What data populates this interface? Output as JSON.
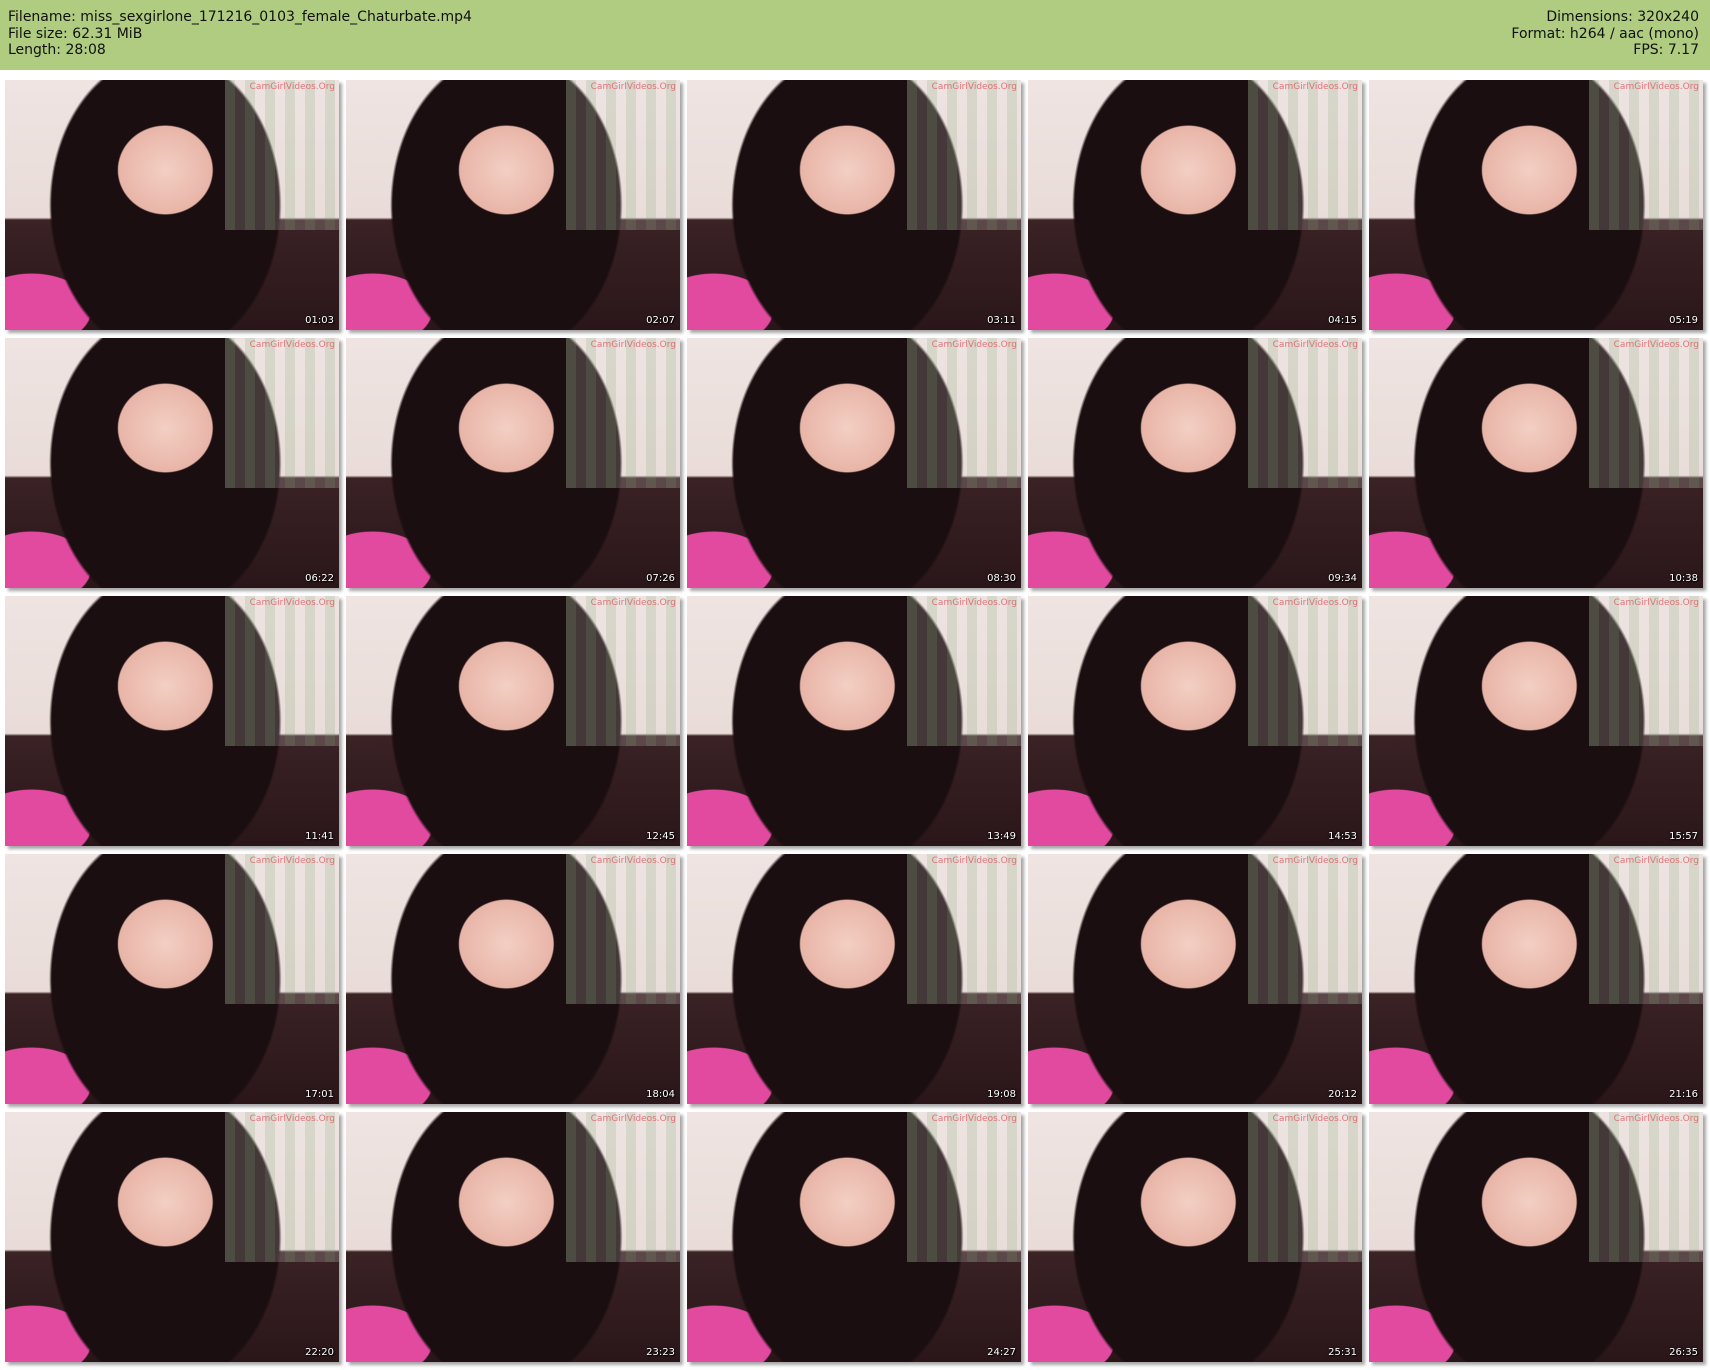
{
  "header": {
    "filename": "Filename: miss_sexgirlone_171216_0103_female_Chaturbate.mp4",
    "filesize": "File size: 62.31 MiB",
    "length": "Length: 28:08",
    "dimensions": "Dimensions: 320x240",
    "format": "Format: h264 / aac (mono)",
    "fps": "FPS: 7.17"
  },
  "watermark": "CamGirlVideos.Org",
  "thumbnails": [
    {
      "timestamp": "01:03"
    },
    {
      "timestamp": "02:07"
    },
    {
      "timestamp": "03:11"
    },
    {
      "timestamp": "04:15"
    },
    {
      "timestamp": "05:19"
    },
    {
      "timestamp": "06:22"
    },
    {
      "timestamp": "07:26"
    },
    {
      "timestamp": "08:30"
    },
    {
      "timestamp": "09:34"
    },
    {
      "timestamp": "10:38"
    },
    {
      "timestamp": "11:41"
    },
    {
      "timestamp": "12:45"
    },
    {
      "timestamp": "13:49"
    },
    {
      "timestamp": "14:53"
    },
    {
      "timestamp": "15:57"
    },
    {
      "timestamp": "17:01"
    },
    {
      "timestamp": "18:04"
    },
    {
      "timestamp": "19:08"
    },
    {
      "timestamp": "20:12"
    },
    {
      "timestamp": "21:16"
    },
    {
      "timestamp": "22:20"
    },
    {
      "timestamp": "23:23"
    },
    {
      "timestamp": "24:27"
    },
    {
      "timestamp": "25:31"
    },
    {
      "timestamp": "26:35"
    }
  ]
}
